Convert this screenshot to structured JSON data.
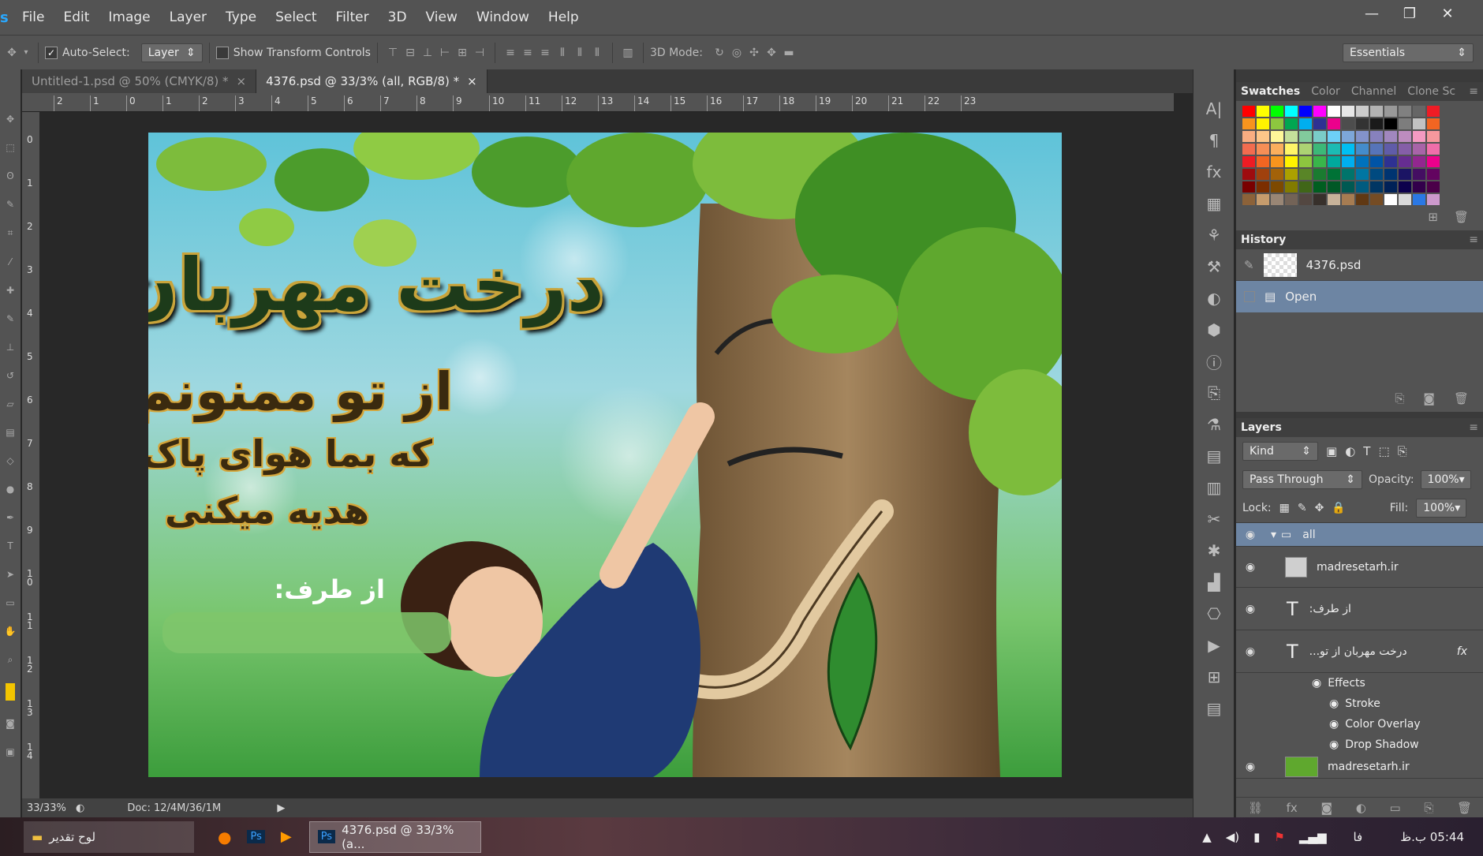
{
  "menu": {
    "logo": "s",
    "items": [
      "File",
      "Edit",
      "Image",
      "Layer",
      "Type",
      "Select",
      "Filter",
      "3D",
      "View",
      "Window",
      "Help"
    ]
  },
  "window_buttons": [
    "—",
    "❐",
    "✕"
  ],
  "options": {
    "auto_select_label": "Auto-Select:",
    "auto_select_value": "Layer",
    "show_transform_label": "Show Transform Controls",
    "mode3d_label": "3D Mode:",
    "workspace": "Essentials"
  },
  "tabs": [
    {
      "label": "Untitled-1.psd @ 50% (CMYK/8) *",
      "close": "×"
    },
    {
      "label": "4376.psd @ 33/3% (all, RGB/8) *",
      "close": "×"
    }
  ],
  "ruler_h": [
    "2",
    "1",
    "0",
    "1",
    "2",
    "3",
    "4",
    "5",
    "6",
    "7",
    "8",
    "9",
    "10",
    "11",
    "12",
    "13",
    "14",
    "15",
    "16",
    "17",
    "18",
    "19",
    "20",
    "21",
    "22",
    "23"
  ],
  "ruler_v": [
    "0",
    "1",
    "2",
    "3",
    "4",
    "5",
    "6",
    "7",
    "8",
    "9",
    "1\n0",
    "1\n1",
    "1\n2",
    "1\n3",
    "1\n4"
  ],
  "status": {
    "zoom": "33/33%",
    "doc": "Doc: 12/4M/36/1M"
  },
  "document": {
    "title": "درخت مهربان",
    "line1": "از تو ممنونم",
    "line2": "که بما هوای پاک",
    "line3": "هدیه میکنی",
    "from": "از طرف:"
  },
  "swatches_tabs": [
    "Swatches",
    "Color",
    "Channel",
    "Clone Sc"
  ],
  "swatch_colors": [
    "#ff0000",
    "#ffff00",
    "#00ff00",
    "#00ffff",
    "#0000ff",
    "#ff00ff",
    "#ffffff",
    "#e6e6e6",
    "#cccccc",
    "#b3b3b3",
    "#999999",
    "#808080",
    "#666666",
    "#ee1c25",
    "#f7941d",
    "#fff200",
    "#8dc63f",
    "#00a651",
    "#00aeef",
    "#2e3192",
    "#ec008c",
    "#4d4d4d",
    "#333333",
    "#1a1a1a",
    "#000000",
    "#7d7d7d",
    "#c2c2c2",
    "#f26522",
    "#f9ad81",
    "#fdc689",
    "#fff799",
    "#c4df9b",
    "#82ca9c",
    "#7accc8",
    "#6dcff6",
    "#7da7d9",
    "#8393ca",
    "#8781bd",
    "#a187be",
    "#bd8cbf",
    "#f49ac2",
    "#f6989d",
    "#f26c4f",
    "#f68e56",
    "#fbaf5d",
    "#fff568",
    "#acd373",
    "#3cb878",
    "#1cbbb4",
    "#00bff3",
    "#448ccb",
    "#5674b9",
    "#605ca8",
    "#855fa8",
    "#a864a8",
    "#f06eaa",
    "#ed1c24",
    "#f26522",
    "#f7941d",
    "#fff200",
    "#8dc63f",
    "#39b54a",
    "#00a99d",
    "#00aeef",
    "#0072bc",
    "#0054a6",
    "#2e3192",
    "#662d91",
    "#92278f",
    "#ec008c",
    "#9e0b0f",
    "#a0410d",
    "#a36209",
    "#aba000",
    "#598527",
    "#1a7b30",
    "#007236",
    "#00746b",
    "#0076a3",
    "#004a80",
    "#003471",
    "#1b1464",
    "#440e62",
    "#630460",
    "#790000",
    "#7b2e00",
    "#7d4900",
    "#827b00",
    "#406618",
    "#005e20",
    "#005826",
    "#005952",
    "#005b7f",
    "#003663",
    "#002157",
    "#0d004c",
    "#32004b",
    "#4b0049",
    "#8c6239",
    "#c69c6d",
    "#998675",
    "#736357",
    "#534741",
    "#37302b",
    "#c7b299",
    "#a67c52",
    "#603813",
    "#754c24",
    "#ffffff",
    "#d9d9d9",
    "#2b78e4",
    "#cc99cc"
  ],
  "history": {
    "title": "History",
    "snapshot": "4376.psd",
    "step": "Open"
  },
  "layers": {
    "title": "Layers",
    "kind": "Kind",
    "blend": "Pass Through",
    "opacity_label": "Opacity:",
    "opacity": "100%",
    "lock_label": "Lock:",
    "fill_label": "Fill:",
    "fill": "100%",
    "rows": [
      {
        "name": "all",
        "type": "group"
      },
      {
        "name": "madresetarh.ir",
        "type": "smart"
      },
      {
        "name": "از طرف:",
        "type": "text"
      },
      {
        "name": "درخت مهربان از تو...",
        "type": "text",
        "fx": "fx"
      }
    ],
    "effects": [
      "Effects",
      "Stroke",
      "Color Overlay",
      "Drop Shadow"
    ],
    "last_row": "madresetarh.ir"
  },
  "taskbar": {
    "folder": "لوح تقدير",
    "ps_window": "4376.psd @ 33/3% (a...",
    "lang": "فا",
    "clock": "05:44 ب.ظ"
  }
}
